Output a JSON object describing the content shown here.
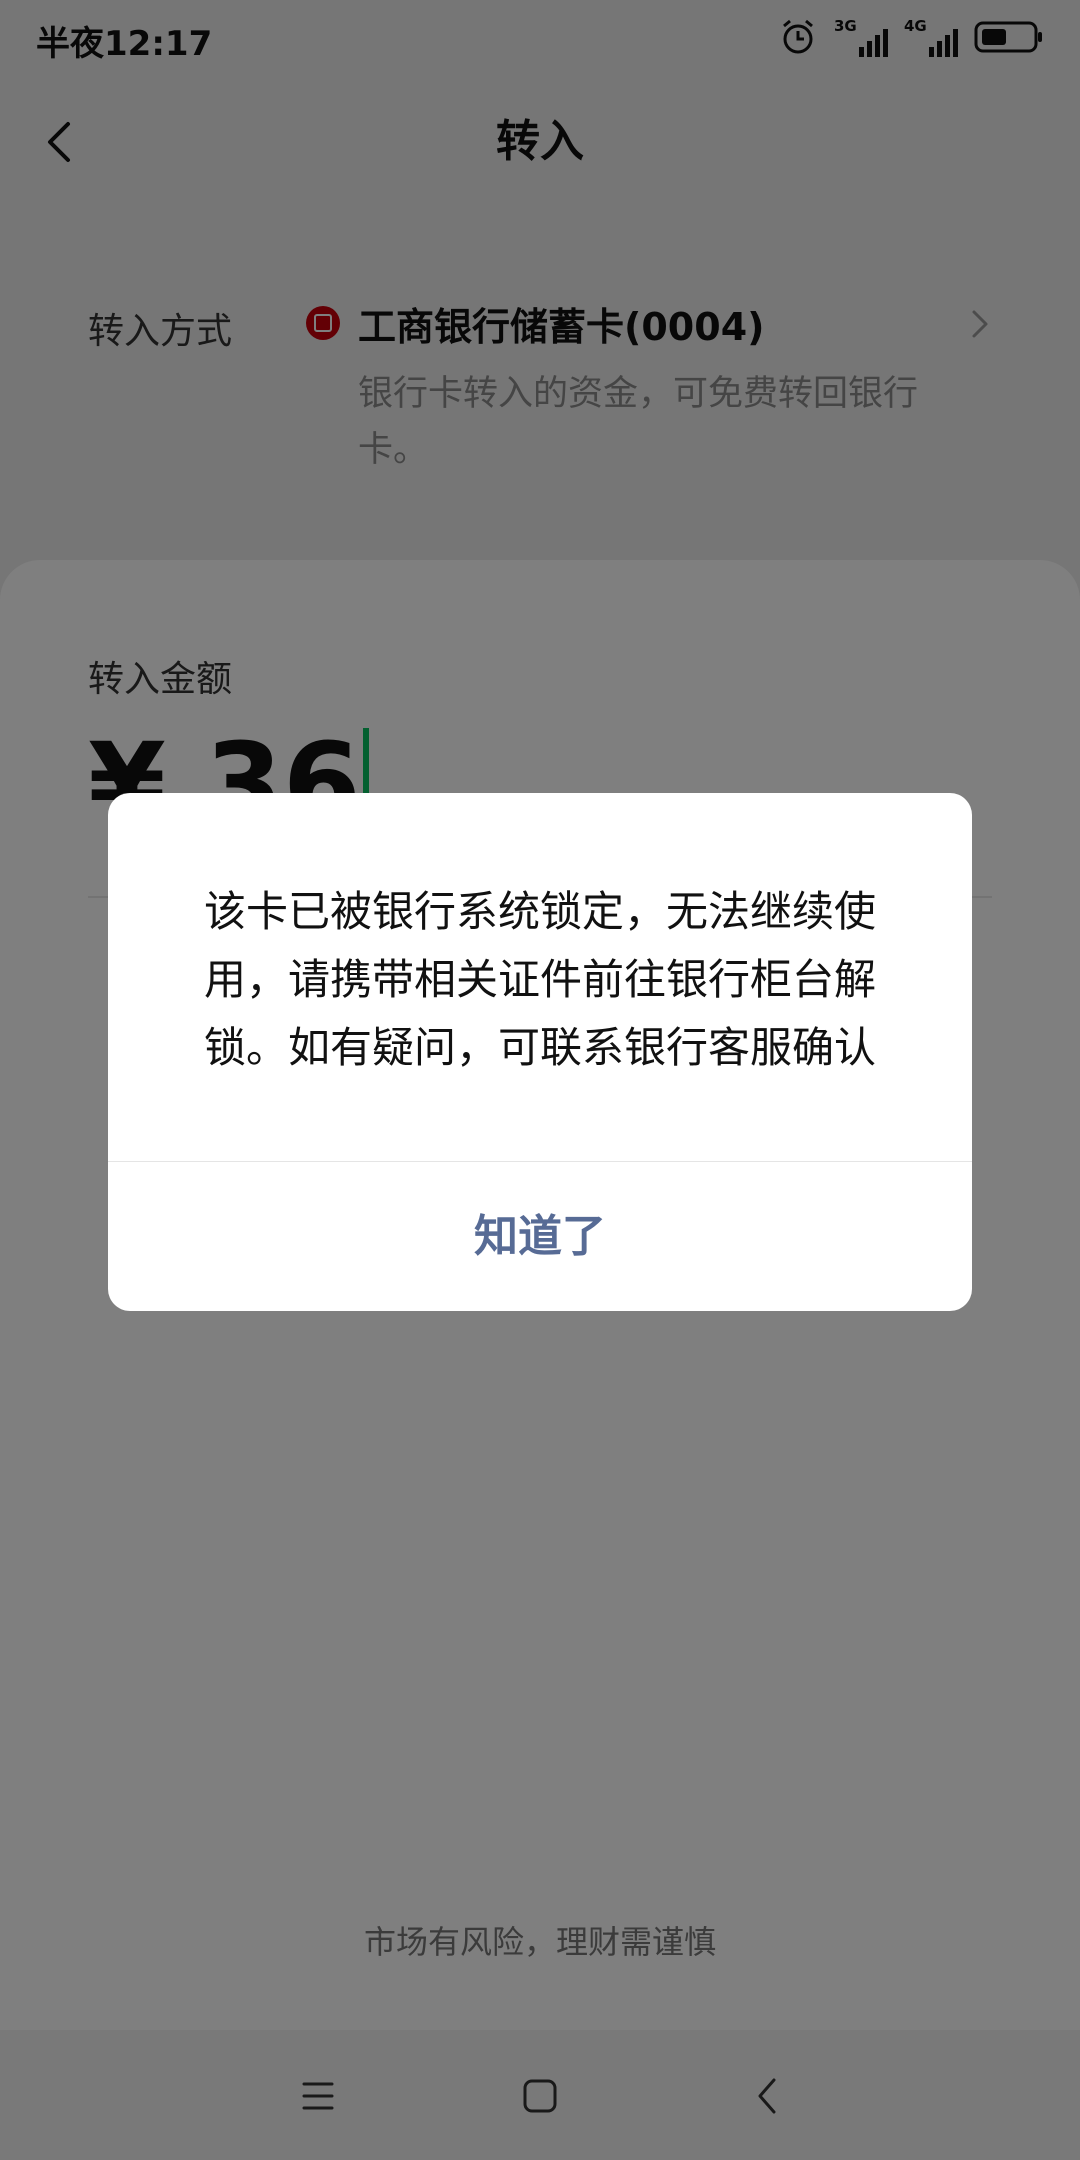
{
  "status_bar": {
    "time": "半夜12:17",
    "network_1": "3G",
    "network_2": "4G"
  },
  "header": {
    "title": "转入"
  },
  "transfer_method": {
    "label": "转入方式",
    "card_name": "工商银行储蓄卡(0004)",
    "note": "银行卡转入的资金，可免费转回银行卡。"
  },
  "amount": {
    "label": "转入金额",
    "value": "¥ 36"
  },
  "footer": {
    "risk_note": "市场有风险，理财需谨慎"
  },
  "dialog": {
    "message": "该卡已被银行系统锁定，无法继续使用，请携带相关证件前往银行柜台解锁。如有疑问，可联系银行客服确认",
    "confirm_label": "知道了"
  },
  "colors": {
    "accent_link": "#576b95",
    "cursor": "#07c160",
    "bank_logo": "#c7000b"
  }
}
